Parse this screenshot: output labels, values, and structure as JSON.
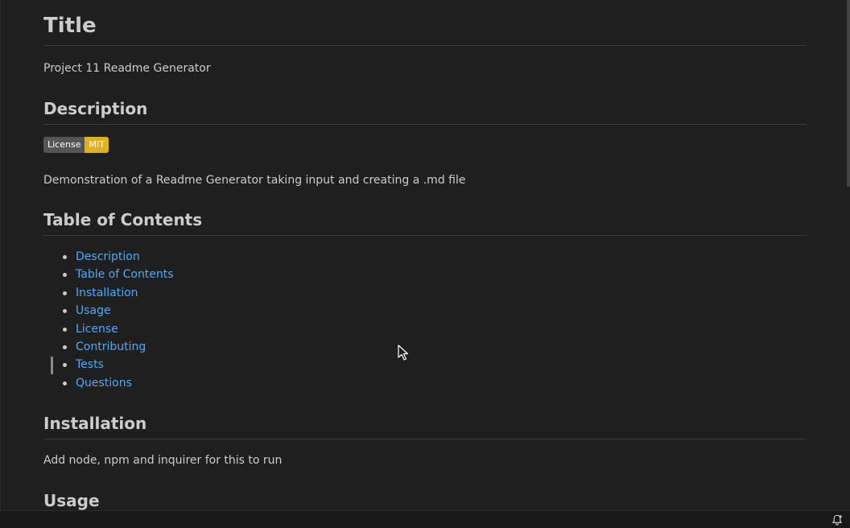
{
  "readme": {
    "title_heading": "Title",
    "title_text": "Project 11 Readme Generator",
    "description_heading": "Description",
    "badge": {
      "label": "License",
      "value": "MIT",
      "label_color": "#555555",
      "value_color": "#dfb317"
    },
    "description_text": "Demonstration of a Readme Generator taking input and creating a .md file",
    "toc_heading": "Table of Contents",
    "toc_items": [
      "Description",
      "Table of Contents",
      "Installation",
      "Usage",
      "License",
      "Contributing",
      "Tests",
      "Questions"
    ],
    "installation_heading": "Installation",
    "installation_text": "Add node, npm and inquirer for this to run",
    "usage_heading": "Usage"
  },
  "statusbar": {
    "icon": "bell-icon"
  },
  "colors": {
    "background": "#1f1f1f",
    "link": "#4daafc",
    "text": "#cccccc"
  }
}
